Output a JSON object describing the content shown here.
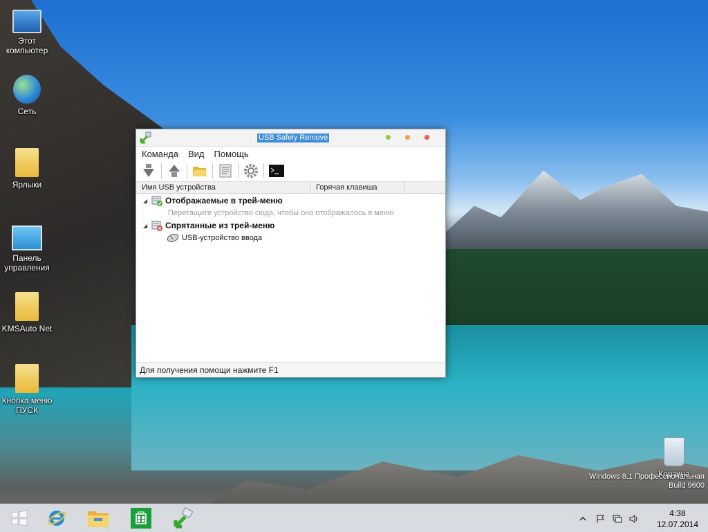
{
  "desktop": {
    "icons": [
      {
        "label": "Этот компьютер",
        "icon": "computer-icon"
      },
      {
        "label": "Сеть",
        "icon": "network-icon"
      },
      {
        "label": "Ярлыки",
        "icon": "folder-icon"
      },
      {
        "label": "Панель управления",
        "icon": "control-panel-icon"
      },
      {
        "label": "KMSAuto Net",
        "icon": "folder-icon"
      },
      {
        "label": "Кнопка меню ПУСК",
        "icon": "folder-icon"
      }
    ],
    "recycle_bin": {
      "label": "Корзина",
      "icon": "recycle-bin-icon"
    },
    "watermark": {
      "line1": "Windows 8.1 Профессиональная",
      "line2": "Build 9600"
    }
  },
  "window": {
    "title": "USB Safely Remove",
    "menu": [
      "Команда",
      "Вид",
      "Помощь"
    ],
    "toolbar_icons": [
      "stop-device-icon",
      "return-device-icon",
      "open-folder-icon",
      "properties-icon",
      "settings-icon",
      "command-line-icon"
    ],
    "columns": [
      "Имя USB устройства",
      "Горячая клавиша"
    ],
    "tree": {
      "group1": {
        "label": "Отображаемые в трей-меню",
        "hint": "Перетащите устройство сюда, чтобы оно отображалось в меню"
      },
      "group2": {
        "label": "Спрятанные из трей-меню",
        "device": "USB-устройство ввода"
      }
    },
    "status": "Для получения помощи нажмите F1",
    "colors": {
      "dot_green": "#8fcf3a",
      "dot_orange": "#f3a33b",
      "dot_red": "#ec5a54",
      "title_highlight": "#3d8ee0"
    }
  },
  "taskbar": {
    "items": [
      "start-icon",
      "internet-explorer-icon",
      "file-explorer-icon",
      "store-icon",
      "usb-safely-remove-icon"
    ],
    "tray": [
      "chevron-up-icon",
      "flag-icon",
      "network-icon",
      "volume-icon"
    ],
    "time": "4:38",
    "date": "12.07.2014"
  }
}
